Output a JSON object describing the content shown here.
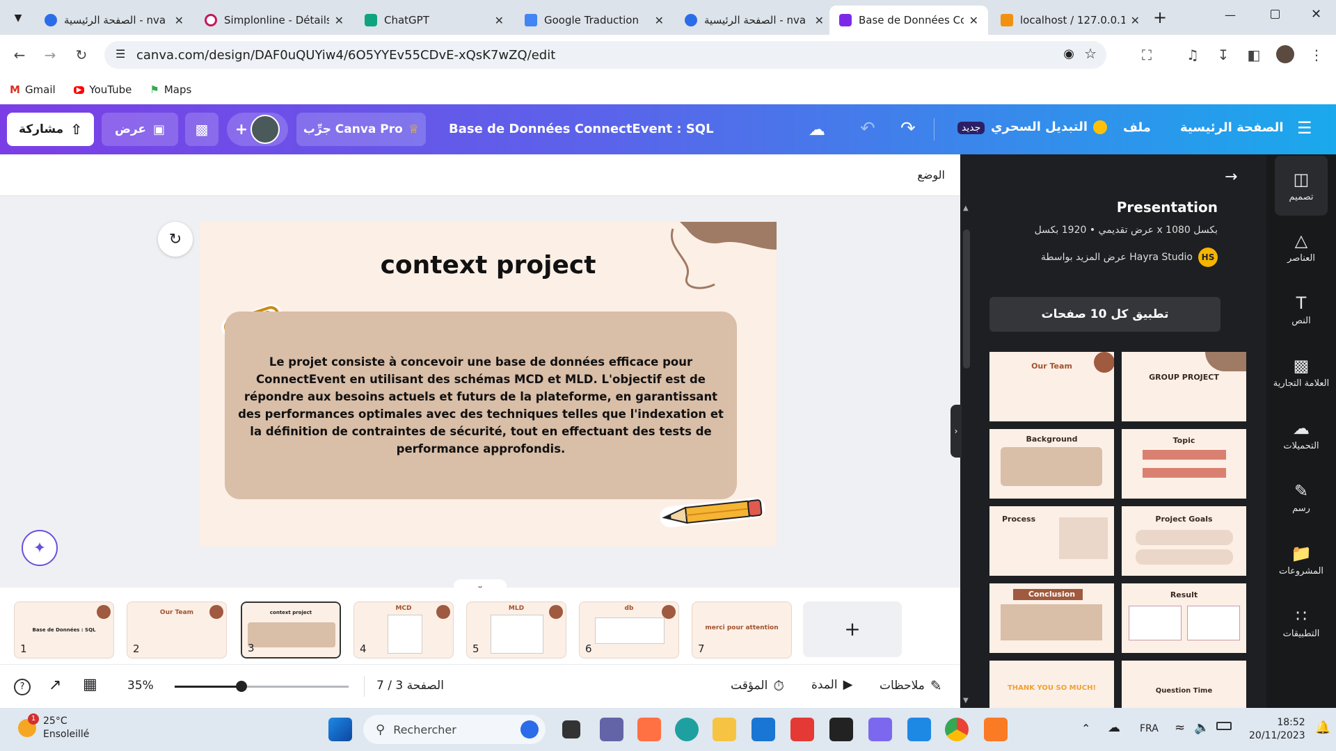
{
  "browser": {
    "tabs": [
      {
        "title": "الصفحة الرئيسية - nva",
        "color": "#2b6de8"
      },
      {
        "title": "Simplonline - Détails",
        "color": "#c2185b"
      },
      {
        "title": "ChatGPT",
        "color": "#10a37f"
      },
      {
        "title": "Google Traduction",
        "color": "#4285f4"
      },
      {
        "title": "الصفحة الرئيسية - nva",
        "color": "#2b6de8"
      },
      {
        "title": "Base de Données Co",
        "color": "#7d2ae8"
      },
      {
        "title": "localhost / 127.0.0.1",
        "color": "#f29111"
      }
    ],
    "new_tab": "+",
    "url": "canva.com/design/DAF0uQUYiw4/6O5YYEv55CDvE-xQsK7wZQ/edit",
    "bookmarks": [
      "Gmail",
      "YouTube",
      "Maps"
    ]
  },
  "canva_header": {
    "menu_home": "الصفحة الرئيسية",
    "menu_file": "ملف",
    "magic_switch": "التبديل السحري",
    "new_badge": "جديد",
    "doc_title": "Base de Données ConnectEvent : SQL",
    "try_pro": "جرِّب Canva Pro",
    "present": "عرض",
    "share": "مشاركة"
  },
  "editor": {
    "position_label": "الوضع",
    "slide": {
      "title": "context project",
      "body": "Le projet consiste à concevoir une base de données efficace pour ConnectEvent en utilisant des schémas MCD et MLD. L'objectif est de répondre aux besoins actuels et futurs de la plateforme, en garantissant des performances optimales avec des techniques telles que l'indexation et la définition de contraintes de sécurité, tout en effectuant des tests de performance approfondis."
    },
    "thumbnails": [
      {
        "num": "1",
        "label": "Base de Données : SQL"
      },
      {
        "num": "2",
        "label": "Our Team"
      },
      {
        "num": "3",
        "label": "context project"
      },
      {
        "num": "4",
        "label": "MCD"
      },
      {
        "num": "5",
        "label": "MLD"
      },
      {
        "num": "6",
        "label": "db"
      },
      {
        "num": "7",
        "label": "merci pour attention"
      }
    ],
    "add_page": "+",
    "zoom": "35%",
    "zoom_level": 0.35,
    "page_indicator": "الصفحة 3 / 7",
    "timer": "المؤقت",
    "duration": "المدة",
    "notes": "ملاحظات"
  },
  "design_panel": {
    "heading": "Presentation",
    "meta": "عرض تقديمي • 1920 بكسل x 1080 بكسل",
    "author_line": "عرض المزيد بواسطة Hayra Studio",
    "author_initials": "HS",
    "apply_all": "تطبيق كل 10 صفحات",
    "templates": [
      "Our Team",
      "GROUP PROJECT",
      "Background",
      "Topic",
      "Process",
      "Project Goals",
      "Conclusion",
      "Result",
      "THANK YOU SO MUCH!",
      "Question Time"
    ]
  },
  "rail": [
    "تصميم",
    "العناصر",
    "النص",
    "العلامة التجارية",
    "التحميلات",
    "رسم",
    "المشروعات",
    "التطبيقات"
  ],
  "taskbar": {
    "weather_temp": "25°C",
    "weather_desc": "Ensoleillé",
    "weather_badge": "1",
    "search": "Rechercher",
    "lang": "FRA",
    "time": "18:52",
    "date": "20/11/2023"
  }
}
